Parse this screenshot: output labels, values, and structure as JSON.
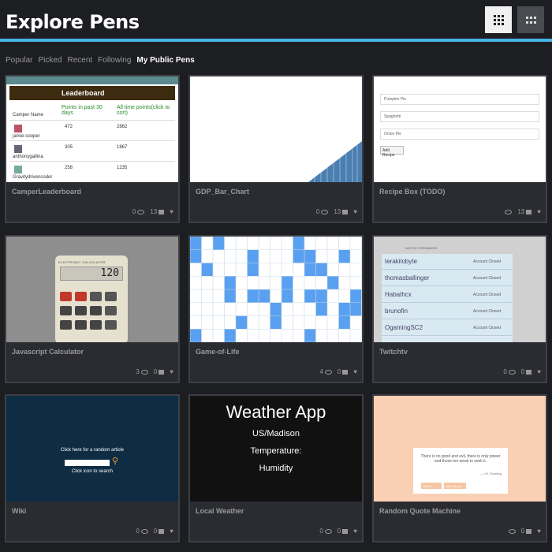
{
  "header": {
    "title": "Explore Pens"
  },
  "tabs": [
    {
      "label": "Popular"
    },
    {
      "label": "Picked"
    },
    {
      "label": "Recent"
    },
    {
      "label": "Following"
    },
    {
      "label": "My Public Pens"
    }
  ],
  "colors": {
    "accent": "#47b3e6",
    "background": "#1d1e22",
    "card": "#2b2c31"
  },
  "pens": [
    {
      "title": "CamperLeaderboard",
      "views": "0",
      "comments": "13",
      "heart": "♥"
    },
    {
      "title": "GDP_Bar_Chart",
      "views": "0",
      "comments": "13",
      "heart": "♥"
    },
    {
      "title": "Recipe Box (TODO)",
      "views": "",
      "comments": "13",
      "heart": "♥"
    },
    {
      "title": "Javascript Calculator",
      "views": "3",
      "comments": "0",
      "heart": "♥"
    },
    {
      "title": "Game-of-Life",
      "views": "4",
      "comments": "0",
      "heart": "♥"
    },
    {
      "title": "Twitchtv",
      "views": "0",
      "comments": "0",
      "heart": "♥"
    },
    {
      "title": "Wiki",
      "views": "0",
      "comments": "0",
      "heart": "♥"
    },
    {
      "title": "Local Weather",
      "views": "0",
      "comments": "0",
      "heart": "♥"
    },
    {
      "title": "Random Quote Machine",
      "views": "",
      "comments": "0",
      "heart": "♥"
    }
  ],
  "leaderboard": {
    "heading": "Leaderboard",
    "col_name": "Camper Name",
    "col_30": "Points in past 30 days",
    "col_all": "All time points(click to sort)",
    "rows": [
      {
        "name": "jamie-cooper",
        "p30": "472",
        "pall": "2862"
      },
      {
        "name": "anthonygallina",
        "p30": "305",
        "pall": "1867"
      },
      {
        "name": "Gravitydrivencoder",
        "p30": "258",
        "pall": "1235"
      }
    ]
  },
  "recipe": {
    "items": [
      "Pumpkin Pie",
      "Spaghetti",
      "Onion Pie"
    ],
    "button": "Add Recipe"
  },
  "calculator": {
    "brand": "ELECTRONIC CALCULATOR",
    "display": "120"
  },
  "twitch": {
    "header": "WATCH STREAMERS",
    "streams": [
      {
        "name": "terakilobyte",
        "status": "Account Closed"
      },
      {
        "name": "thomasballinger",
        "status": "Account Closed"
      },
      {
        "name": "Habathcx",
        "status": "Account Closed"
      },
      {
        "name": "brunofin",
        "status": "Account Closed"
      },
      {
        "name": "OgamingSC2",
        "status": "Account Closed"
      }
    ]
  },
  "wiki": {
    "prompt": "Click here for a random article",
    "link": "Click icon to search"
  },
  "weather": {
    "title": "Weather App",
    "location": "US/Madison",
    "temp_label": "Temperature:",
    "humidity_label": "Humidity"
  },
  "quote": {
    "text": "There is no good and evil, there is only power and those too weak to seek it.",
    "author": "— J.K. Rowling",
    "btn1": "Tweet",
    "btn2": "New Quote"
  }
}
